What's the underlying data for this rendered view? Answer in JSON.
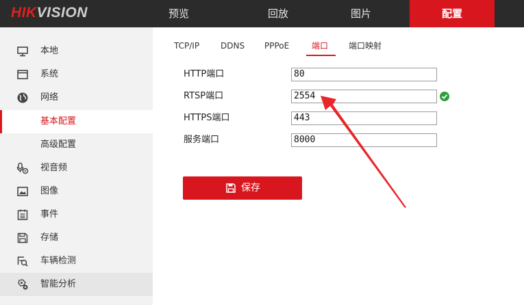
{
  "logo": {
    "part1": "HIK",
    "part2": "VISION"
  },
  "topnav": [
    {
      "label": "预览"
    },
    {
      "label": "回放"
    },
    {
      "label": "图片"
    },
    {
      "label": "配置"
    }
  ],
  "sidebar": {
    "items": [
      {
        "label": "本地",
        "icon": "monitor-icon"
      },
      {
        "label": "系统",
        "icon": "window-icon"
      },
      {
        "label": "网络",
        "icon": "globe-icon"
      },
      {
        "label": "基本配置",
        "state": "selected"
      },
      {
        "label": "高级配置"
      },
      {
        "label": "视音频",
        "icon": "audio-video-icon"
      },
      {
        "label": "图像",
        "icon": "image-icon"
      },
      {
        "label": "事件",
        "icon": "event-list-icon"
      },
      {
        "label": "存储",
        "icon": "storage-icon"
      },
      {
        "label": "车辆检测",
        "icon": "vehicle-detect-icon"
      },
      {
        "label": "智能分析",
        "icon": "smart-analysis-icon"
      }
    ]
  },
  "tabs": [
    {
      "label": "TCP/IP"
    },
    {
      "label": "DDNS"
    },
    {
      "label": "PPPoE"
    },
    {
      "label": "端口",
      "active": true
    },
    {
      "label": "端口映射"
    }
  ],
  "form": {
    "fields": [
      {
        "label": "HTTP端口",
        "value": "80"
      },
      {
        "label": "RTSP端口",
        "value": "2554",
        "status": "valid"
      },
      {
        "label": "HTTPS端口",
        "value": "443"
      },
      {
        "label": "服务端口",
        "value": "8000"
      }
    ],
    "save_label": "保存"
  },
  "colors": {
    "accent": "#d8161e",
    "topbar": "#2b2b2b",
    "sidebar_bg": "#f2f2f2",
    "valid": "#2e9e3a",
    "annotation_arrow": "#e8262b"
  }
}
